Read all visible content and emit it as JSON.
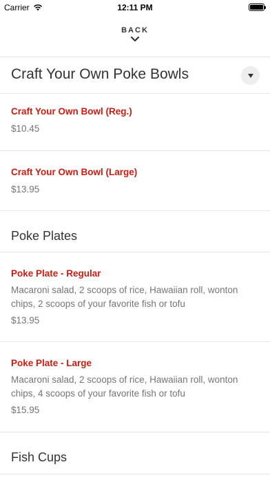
{
  "status_bar": {
    "carrier": "Carrier",
    "time": "12:11 PM"
  },
  "header": {
    "back_label": "BACK"
  },
  "sections": [
    {
      "title": "Craft Your Own Poke Bowls",
      "items": [
        {
          "name": "Craft Your Own Bowl (Reg.)",
          "price": "$10.45"
        },
        {
          "name": "Craft Your Own Bowl (Large)",
          "price": "$13.95"
        }
      ]
    },
    {
      "title": "Poke Plates",
      "items": [
        {
          "name": "Poke Plate - Regular",
          "description": "Macaroni salad, 2 scoops of rice, Hawaiian roll, wonton chips, 2 scoops of your favorite fish or tofu",
          "price": "$13.95"
        },
        {
          "name": "Poke Plate - Large",
          "description": "Macaroni salad, 2 scoops of rice, Hawaiian roll, wonton chips, 4 scoops of your favorite fish or tofu",
          "price": "$15.95"
        }
      ]
    },
    {
      "title": "Fish Cups",
      "items": []
    }
  ],
  "icons": {
    "wifi": "wifi-icon",
    "battery": "battery-icon",
    "back": "chevron-down-icon",
    "dropdown": "caret-down-icon"
  },
  "colors": {
    "item_name": "#cc1b10",
    "text_muted": "#757575",
    "divider": "#e6e6e6"
  }
}
